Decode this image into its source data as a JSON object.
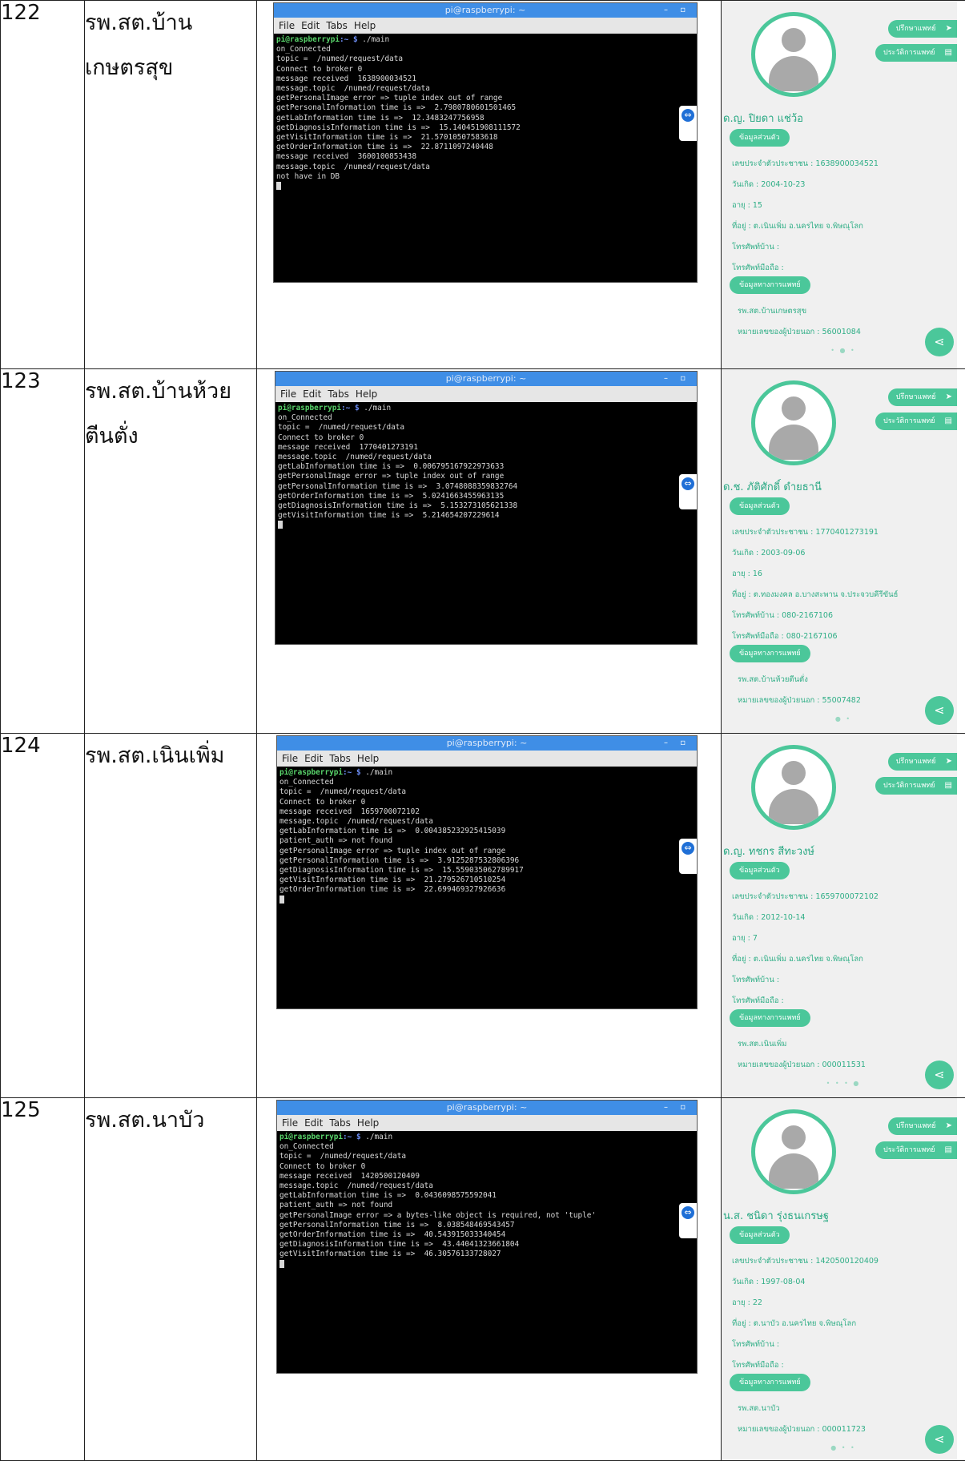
{
  "rows": [
    {
      "number": "122",
      "hospital_lines": [
        "รพ.สต.บ้าน",
        "เกษตรสุข"
      ],
      "terminal": {
        "title": "pi@raspberrypi: ~",
        "menu": [
          "File",
          "Edit",
          "Tabs",
          "Help"
        ],
        "prompt_user": "pi@raspberrypi",
        "prompt_path": ":~ $",
        "command": " ./main",
        "lines": [
          "on_Connected",
          "topic =  /numed/request/data",
          "Connect to broker 0",
          "message received  1638900034521",
          "message.topic  /numed/request/data",
          "getPersonalImage error => tuple index out of range",
          "getPersonalInformation time is =>  2.7980780601501465",
          "getLabInformation time is =>  12.3483247756958",
          "getDiagnosisInformation time is =>  15.140451908111572",
          "getVisitInformation time is =>  21.57010507583618",
          "getOrderInformation time is =>  22.8711097240448",
          "message received  3600100853438",
          "message.topic  /numed/request/data",
          "not have in DB"
        ]
      },
      "phone": {
        "btn_consult": "ปรึกษาแพทย์",
        "btn_history": "ประวัติการแพทย์",
        "name": "ด.ญ. ปิยดา แช่ว้อ",
        "section_personal": "ข้อมูลส่วนตัว",
        "fields": [
          "เลขประจำตัวประชาชน : 1638900034521",
          "วันเกิด : 2004-10-23",
          "อายุ : 15",
          "ที่อยู่ : ต.เนินเพิ่ม อ.นครไทย จ.พิษณุโลก",
          "โทรศัพท์บ้าน :",
          "โทรศัพท์มือถือ :"
        ],
        "section_medical": "ข้อมูลทางการแพทย์",
        "facility": "รพ.สต.บ้านเกษตรสุข",
        "hn": "หมายเลขของผู้ป่วยนอก : 56001084",
        "dots": "• ● •"
      }
    },
    {
      "number": "123",
      "hospital_lines": [
        "รพ.สต.บ้านห้วย",
        "ตีนตั่ง"
      ],
      "terminal": {
        "title": "pi@raspberrypi: ~",
        "menu": [
          "File",
          "Edit",
          "Tabs",
          "Help"
        ],
        "prompt_user": "pi@raspberrypi",
        "prompt_path": ":~ $",
        "command": " ./main",
        "lines": [
          "on_Connected",
          "topic =  /numed/request/data",
          "Connect to broker 0",
          "message received  1770401273191",
          "message.topic  /numed/request/data",
          "getLabInformation time is =>  0.006795167922973633",
          "getPersonalImage error => tuple index out of range",
          "getPersonalInformation time is =>  3.0748088359832764",
          "getOrderInformation time is =>  5.0241663455963135",
          "getDiagnosisInformation time is =>  5.153273105621338",
          "getVisitInformation time is =>  5.214654207229614"
        ]
      },
      "phone": {
        "btn_consult": "ปรึกษาแพทย์",
        "btn_history": "ประวัติการแพทย์",
        "name": "ด.ช. ภัติศักดิ์ ดำยธานี",
        "section_personal": "ข้อมูลส่วนตัว",
        "fields": [
          "เลขประจำตัวประชาชน : 1770401273191",
          "วันเกิด : 2003-09-06",
          "อายุ : 16",
          "ที่อยู่ : ต.ทองมงคล อ.บางสะพาน จ.ประจวบคีรีขันธ์",
          "โทรศัพท์บ้าน : 080-2167106",
          "โทรศัพท์มือถือ : 080-2167106"
        ],
        "section_medical": "ข้อมูลทางการแพทย์",
        "facility": "รพ.สต.บ้านห้วยตีนตั่ง",
        "hn": "หมายเลขของผู้ป่วยนอก : 55007482",
        "dots": "● •"
      }
    },
    {
      "number": "124",
      "hospital_lines": [
        "รพ.สต.เนินเพิ่ม"
      ],
      "terminal": {
        "title": "pi@raspberrypi: ~",
        "menu": [
          "File",
          "Edit",
          "Tabs",
          "Help"
        ],
        "prompt_user": "pi@raspberrypi",
        "prompt_path": ":~ $",
        "command": " ./main",
        "lines": [
          "on_Connected",
          "topic =  /numed/request/data",
          "Connect to broker 0",
          "message received  1659700072102",
          "message.topic  /numed/request/data",
          "getLabInformation time is =>  0.004385232925415039",
          "patient_auth => not found",
          "getPersonalImage error => tuple index out of range",
          "getPersonalInformation time is =>  3.9125287532806396",
          "getDiagnosisInformation time is =>  15.559035062789917",
          "getVisitInformation time is =>  21.279526710510254",
          "getOrderInformation time is =>  22.699469327926636"
        ]
      },
      "phone": {
        "btn_consult": "ปรึกษาแพทย์",
        "btn_history": "ประวัติการแพทย์",
        "name": "ด.ญ. ทชกร สีทะวงษ์",
        "section_personal": "ข้อมูลส่วนตัว",
        "fields": [
          "เลขประจำตัวประชาชน : 1659700072102",
          "วันเกิด : 2012-10-14",
          "อายุ : 7",
          "ที่อยู่ : ต.เนินเพิ่ม อ.นครไทย จ.พิษณุโลก",
          "โทรศัพท์บ้าน :",
          "โทรศัพท์มือถือ :"
        ],
        "section_medical": "ข้อมูลทางการแพทย์",
        "facility": "รพ.สต.เนินเพิ่ม",
        "hn": "หมายเลขของผู้ป่วยนอก : 000011531",
        "dots": "• • • ●"
      }
    },
    {
      "number": "125",
      "hospital_lines": [
        "รพ.สต.นาบัว"
      ],
      "terminal": {
        "title": "pi@raspberrypi: ~",
        "menu": [
          "File",
          "Edit",
          "Tabs",
          "Help"
        ],
        "prompt_user": "pi@raspberrypi",
        "prompt_path": ":~ $",
        "command": " ./main",
        "lines": [
          "on_Connected",
          "topic =  /numed/request/data",
          "Connect to broker 0",
          "message received  1420500120409",
          "message.topic  /numed/request/data",
          "getLabInformation time is =>  0.0436098575592041",
          "patient_auth => not found",
          "getPersonalImage error => a bytes-like object is required, not 'tuple'",
          "getPersonalInformation time is =>  8.038548469543457",
          "getOrderInformation time is =>  40.543915033340454",
          "getDiagnosisInformation time is =>  43.44041323661804",
          "getVisitInformation time is =>  46.30576133728027"
        ]
      },
      "phone": {
        "btn_consult": "ปรึกษาแพทย์",
        "btn_history": "ประวัติการแพทย์",
        "name": "น.ส. ชนิดา รุ่งธนเกรษฐ",
        "section_personal": "ข้อมูลส่วนตัว",
        "fields": [
          "เลขประจำตัวประชาชน : 1420500120409",
          "วันเกิด : 1997-08-04",
          "อายุ : 22",
          "ที่อยู่ : ต.นาบัว อ.นครไทย จ.พิษณุโลก",
          "โทรศัพท์บ้าน :",
          "โทรศัพท์มือถือ :"
        ],
        "section_medical": "ข้อมูลทางการแพทย์",
        "facility": "รพ.สต.นาบัว",
        "hn": "หมายเลขของผู้ป่วยนอก : 000011723",
        "dots": "● • •"
      }
    }
  ]
}
